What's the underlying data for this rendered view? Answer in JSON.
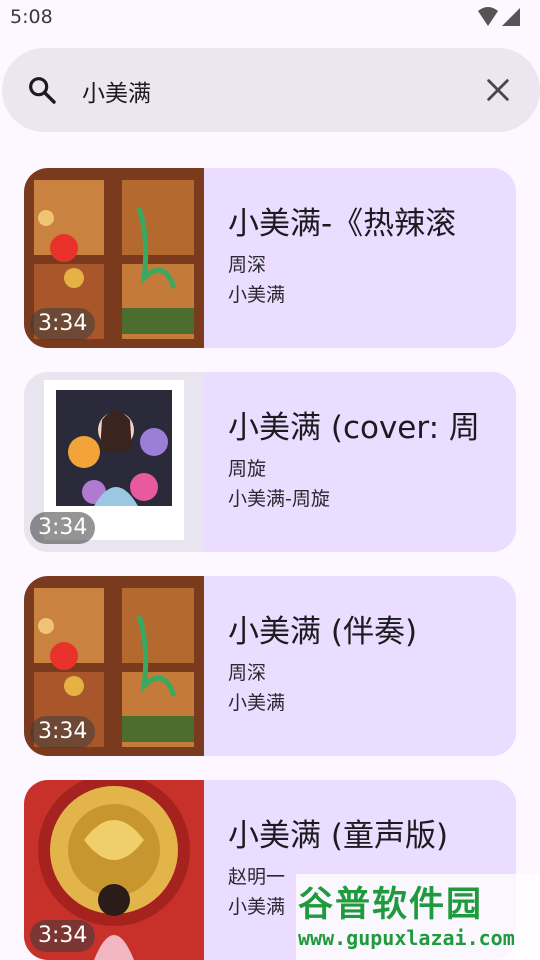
{
  "status_bar": {
    "time": "5:08"
  },
  "search": {
    "query": "小美满",
    "placeholder": ""
  },
  "results": [
    {
      "title": "小美满-《热辣滚",
      "artist": "周深",
      "album": "小美满",
      "duration": "3:34"
    },
    {
      "title": "小美满 (cover: 周",
      "artist": "周旋",
      "album": "小美满-周旋",
      "duration": "3:34"
    },
    {
      "title": "小美满 (伴奏)",
      "artist": "周深",
      "album": "小美满",
      "duration": "3:34"
    },
    {
      "title": "小美满 (童声版)",
      "artist": "赵明一",
      "album": "小美满",
      "duration": "3:34"
    }
  ],
  "watermark": {
    "logo": "谷普软件园",
    "url": "www.gupuxlazai.com"
  },
  "colors": {
    "background": "#fdf7ff",
    "search_bar": "#ece6f0",
    "card": "#eaddff",
    "watermark_green": "#1f9a3c"
  }
}
